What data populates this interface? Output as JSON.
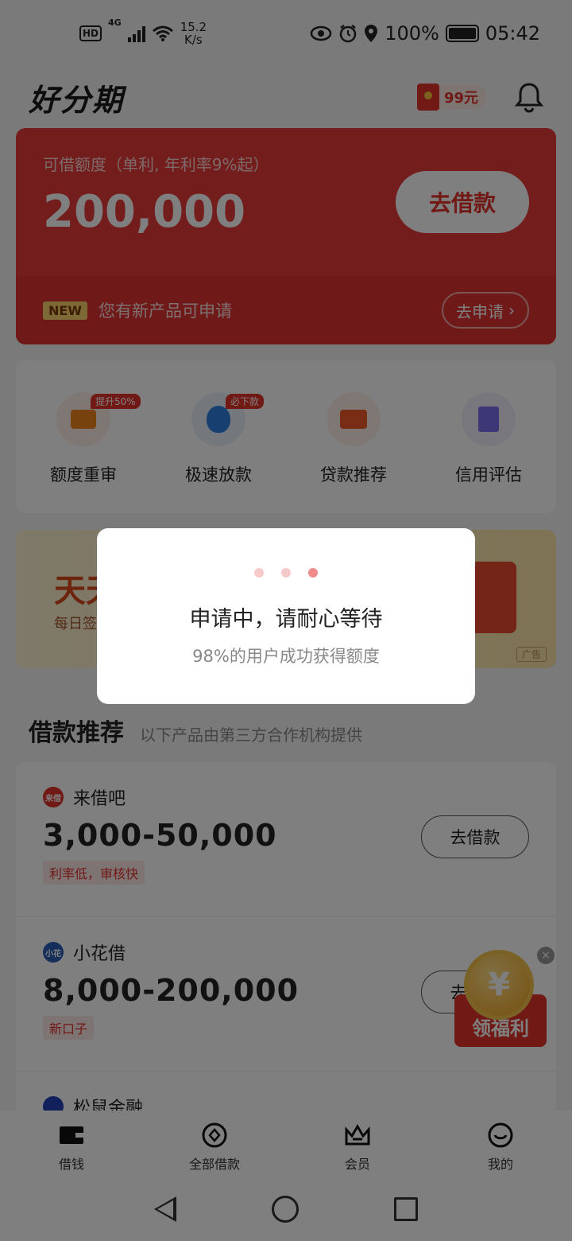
{
  "status_bar": {
    "hd": "HD",
    "net": "4G",
    "speed_value": "15.2",
    "speed_unit": "K/s",
    "battery": "100%",
    "time": "05:42"
  },
  "header": {
    "logo": "好分期",
    "hongbao": "99元"
  },
  "credit_card": {
    "label": "可借额度（单利, 年利率9%起）",
    "amount": "200,000",
    "borrow_button": "去借款",
    "new_tag": "NEW",
    "new_text": "您有新产品可申请",
    "apply_button": "去申请"
  },
  "tools": [
    {
      "label": "额度重审",
      "badge": "提升50%",
      "icon": "wallet-icon"
    },
    {
      "label": "极速放款",
      "badge": "必下款",
      "icon": "money-bag-icon"
    },
    {
      "label": "贷款推荐",
      "badge": "",
      "icon": "purse-icon"
    },
    {
      "label": "信用评估",
      "badge": "",
      "icon": "report-icon"
    }
  ],
  "banner": {
    "title": "天天",
    "subtitle": "每日签",
    "ad_tag": "广告"
  },
  "section": {
    "title": "借款推荐",
    "subtitle": "以下产品由第三方合作机构提供"
  },
  "products": [
    {
      "name": "来借吧",
      "range": "3,000-50,000",
      "tag": "利率低，审核快",
      "button": "去借款",
      "logo_text": "来借"
    },
    {
      "name": "小花借",
      "range": "8,000-200,000",
      "tag": "新口子",
      "button": "去借款",
      "logo_text": "小花"
    },
    {
      "name": "松鼠金融",
      "range": "",
      "tag": "",
      "button": "",
      "logo_text": ""
    }
  ],
  "welfare": {
    "label": "领福利",
    "coin": "¥"
  },
  "tabbar": [
    {
      "label": "借钱",
      "icon": "wallet-tab-icon"
    },
    {
      "label": "全部借款",
      "icon": "target-tab-icon"
    },
    {
      "label": "会员",
      "icon": "crown-tab-icon"
    },
    {
      "label": "我的",
      "icon": "smile-tab-icon"
    }
  ],
  "dialog": {
    "title": "申请中，请耐心等待",
    "subtitle": "98%的用户成功获得额度"
  },
  "colors": {
    "brand_red": "#e3322b",
    "overlay": "rgba(0,0,0,0.5)"
  }
}
